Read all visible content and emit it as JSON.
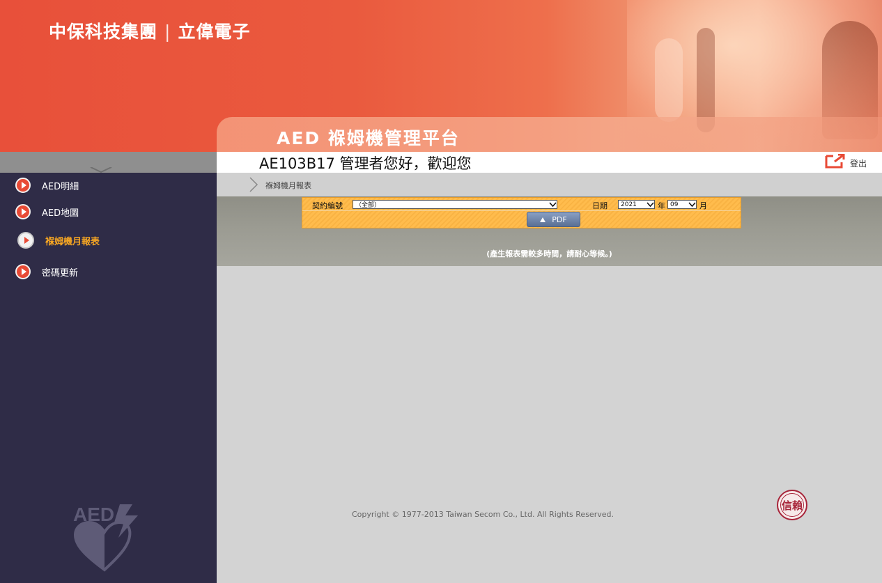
{
  "header": {
    "brand_left": "中保科技集團",
    "brand_sep": "|",
    "brand_right": "立偉電子",
    "app_title": "AED 褓姆機管理平台"
  },
  "welcome": {
    "message": "AE103B17 管理者您好，歡迎您",
    "logout_label": "登出"
  },
  "sidebar": {
    "items": [
      {
        "label": "AED明細",
        "active": false
      },
      {
        "label": "AED地圖",
        "active": false
      },
      {
        "label": "褓姆機月報表",
        "active": true
      },
      {
        "label": "密碼更新",
        "active": false
      }
    ]
  },
  "breadcrumb": {
    "current": "褓姆機月報表"
  },
  "form": {
    "contract_label": "契約編號",
    "contract_value": "（全部）",
    "date_label": "日期",
    "year_value": "2021",
    "year_unit": "年",
    "month_value": "09",
    "month_unit": "月",
    "pdf_label": "PDF",
    "note": "(產生報表需較多時間，請耐心等候。)"
  },
  "footer": {
    "copyright": "Copyright © 1977-2013 Taiwan Secom Co., Ltd. All Rights Reserved.",
    "seal_text": "信賴"
  },
  "colors": {
    "accent": "#e84a35",
    "sidebar_bg": "#2f2c47",
    "active_item": "#f6a623",
    "form_bg": "#ffbc4d"
  }
}
